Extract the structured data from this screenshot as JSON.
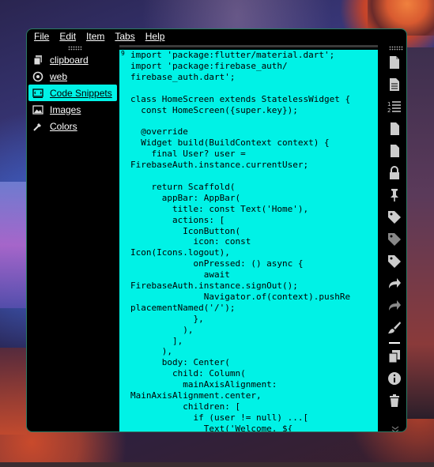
{
  "menu": {
    "items": [
      "File",
      "Edit",
      "Item",
      "Tabs",
      "Help"
    ]
  },
  "sidebar": {
    "items": [
      {
        "label": "clipboard",
        "icon": "copy-icon"
      },
      {
        "label": "web",
        "icon": "globe-icon"
      },
      {
        "label": "Code Snippets",
        "icon": "code-icon",
        "selected": true
      },
      {
        "label": "Images",
        "icon": "image-icon"
      },
      {
        "label": "Colors",
        "icon": "eyedropper-icon"
      }
    ]
  },
  "editor": {
    "corner_marker": "9",
    "content": "import 'package:flutter/material.dart';\nimport 'package:firebase_auth/\nfirebase_auth.dart';\n\nclass HomeScreen extends StatelessWidget {\n  const HomeScreen({super.key});\n\n  @override\n  Widget build(BuildContext context) {\n    final User? user =\nFirebaseAuth.instance.currentUser;\n\n    return Scaffold(\n      appBar: AppBar(\n        title: const Text('Home'),\n        actions: [\n          IconButton(\n            icon: const\nIcon(Icons.logout),\n            onPressed: () async {\n              await\nFirebaseAuth.instance.signOut();\n              Navigator.of(context).pushRe\nplacementNamed('/');\n            },\n          ),\n        ],\n      ),\n      body: Center(\n        child: Column(\n          mainAxisAlignment:\nMainAxisAlignment.center,\n          children: [\n            if (user != null) ...[\n              Text('Welcome, ${"
  },
  "toolbar": {
    "icons": [
      "document-icon",
      "document-lines-icon",
      "numbered-list-icon",
      "file-icon",
      "file-icon-2",
      "lock-icon",
      "pin-icon",
      "tag-icon",
      "tag-icon-2",
      "tag-icon-3",
      "redo-icon",
      "redo-icon-2",
      "brush-icon",
      "copy-icon",
      "info-icon",
      "trash-icon"
    ]
  },
  "colors": {
    "editor_bg": "#00f2e6",
    "selected_bg": "#00f2e6",
    "window_bg": "#000000",
    "window_border": "#2a7a63"
  }
}
